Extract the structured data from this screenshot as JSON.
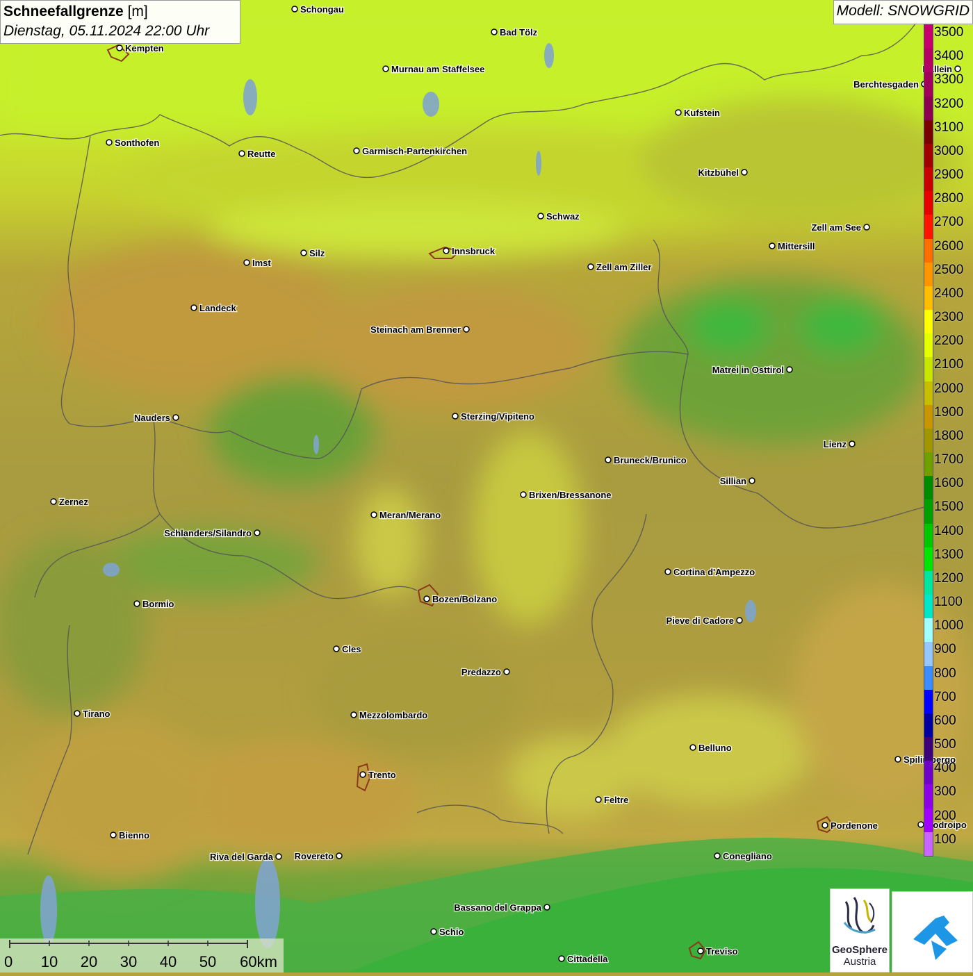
{
  "header": {
    "title_bold": "Schneefallgrenze",
    "title_unit": " [m]",
    "datetime": "Dienstag, 05.11.2024 22:00 Uhr"
  },
  "model": {
    "label": "Modell: SNOWGRID"
  },
  "legend": {
    "unit": "m",
    "levels": [
      {
        "value": "3500",
        "color": "#c8006e"
      },
      {
        "value": "3400",
        "color": "#b40064"
      },
      {
        "value": "3300",
        "color": "#a0005a"
      },
      {
        "value": "3200",
        "color": "#8c0050"
      },
      {
        "value": "3100",
        "color": "#780000"
      },
      {
        "value": "3000",
        "color": "#a00000"
      },
      {
        "value": "2900",
        "color": "#c80000"
      },
      {
        "value": "2800",
        "color": "#e60000"
      },
      {
        "value": "2700",
        "color": "#ff1400"
      },
      {
        "value": "2600",
        "color": "#ff6e00"
      },
      {
        "value": "2500",
        "color": "#ff9600"
      },
      {
        "value": "2400",
        "color": "#ffbe00"
      },
      {
        "value": "2300",
        "color": "#ffff00"
      },
      {
        "value": "2200",
        "color": "#e6ff00"
      },
      {
        "value": "2100",
        "color": "#c8e600"
      },
      {
        "value": "2000",
        "color": "#c8be00"
      },
      {
        "value": "1900",
        "color": "#c89600"
      },
      {
        "value": "1800",
        "color": "#a09600"
      },
      {
        "value": "1700",
        "color": "#6ea000"
      },
      {
        "value": "1600",
        "color": "#008c00"
      },
      {
        "value": "1500",
        "color": "#00a000"
      },
      {
        "value": "1400",
        "color": "#00c800"
      },
      {
        "value": "1300",
        "color": "#00e600"
      },
      {
        "value": "1200",
        "color": "#00e6a0"
      },
      {
        "value": "1100",
        "color": "#00e6c8"
      },
      {
        "value": "1000",
        "color": "#a0ffff"
      },
      {
        "value": "900",
        "color": "#96c8ff"
      },
      {
        "value": "800",
        "color": "#3c8cff"
      },
      {
        "value": "700",
        "color": "#0000ff"
      },
      {
        "value": "600",
        "color": "#0000a0"
      },
      {
        "value": "500",
        "color": "#3c0078"
      },
      {
        "value": "400",
        "color": "#6e00c8"
      },
      {
        "value": "300",
        "color": "#8c00e6"
      },
      {
        "value": "200",
        "color": "#a000ff"
      },
      {
        "value": "100",
        "color": "#c864ff"
      }
    ]
  },
  "cities": [
    {
      "name": "Schongau"
    },
    {
      "name": "Kempten"
    },
    {
      "name": "Bad Tölz"
    },
    {
      "name": "Murnau am Staffelsee"
    },
    {
      "name": "Hallein"
    },
    {
      "name": "Berchtesgaden"
    },
    {
      "name": "Kufstein"
    },
    {
      "name": "Sonthofen"
    },
    {
      "name": "Reutte"
    },
    {
      "name": "Garmisch-Partenkirchen"
    },
    {
      "name": "Kitzbühel"
    },
    {
      "name": "Schwaz"
    },
    {
      "name": "Zell am See"
    },
    {
      "name": "Innsbruck"
    },
    {
      "name": "Mittersill"
    },
    {
      "name": "Imst"
    },
    {
      "name": "Silz"
    },
    {
      "name": "Zell am Ziller"
    },
    {
      "name": "Landeck"
    },
    {
      "name": "Steinach am Brenner"
    },
    {
      "name": "Matrei in Osttirol"
    },
    {
      "name": "Nauders"
    },
    {
      "name": "Sterzing/Vipiteno"
    },
    {
      "name": "Lienz"
    },
    {
      "name": "Bruneck/Brunico"
    },
    {
      "name": "Sillian"
    },
    {
      "name": "Brixen/Bressanone"
    },
    {
      "name": "Zernez"
    },
    {
      "name": "Meran/Merano"
    },
    {
      "name": "Schlanders/Silandro"
    },
    {
      "name": "Cortina d'Ampezzo"
    },
    {
      "name": "Bormio"
    },
    {
      "name": "Bozen/Bolzano"
    },
    {
      "name": "Pieve di Cadore"
    },
    {
      "name": "Cles"
    },
    {
      "name": "Predazzo"
    },
    {
      "name": "Tirano"
    },
    {
      "name": "Mezzolombardo"
    },
    {
      "name": "Belluno"
    },
    {
      "name": "Spilimbergo"
    },
    {
      "name": "Trento"
    },
    {
      "name": "Feltre"
    },
    {
      "name": "Pordenone"
    },
    {
      "name": "Bienno"
    },
    {
      "name": "Riva del Garda"
    },
    {
      "name": "Rovereto"
    },
    {
      "name": "Conegliano"
    },
    {
      "name": "Bassano del Grappa"
    },
    {
      "name": "Schio"
    },
    {
      "name": "Treviso"
    },
    {
      "name": "Cittadella"
    },
    {
      "name": "Codroipo"
    }
  ],
  "scale": {
    "ticks": [
      "0",
      "10",
      "20",
      "30",
      "40",
      "50",
      "60km"
    ]
  },
  "logos": {
    "geosphere_line1": "GeoSphere",
    "geosphere_line2": "Austria"
  }
}
